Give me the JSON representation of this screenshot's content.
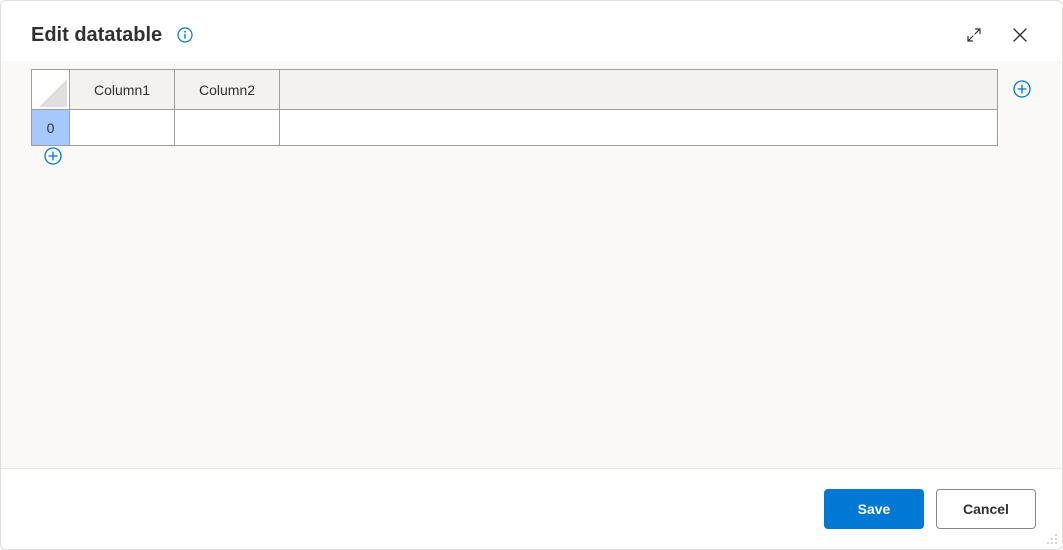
{
  "dialog": {
    "title": "Edit datatable"
  },
  "table": {
    "columns": [
      "Column1",
      "Column2",
      ""
    ],
    "rows": [
      {
        "index": "0",
        "cells": [
          "",
          "",
          ""
        ]
      }
    ]
  },
  "buttons": {
    "save": "Save",
    "cancel": "Cancel"
  }
}
